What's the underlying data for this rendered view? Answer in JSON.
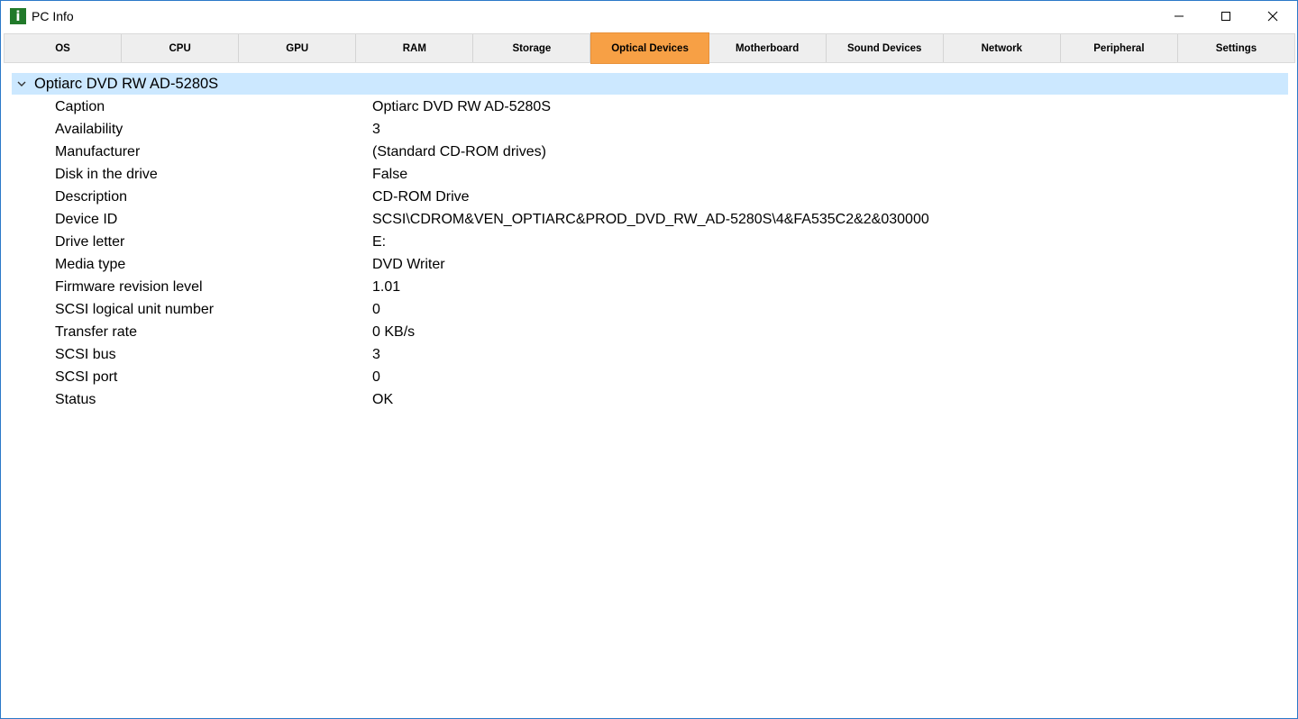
{
  "window": {
    "title": "PC Info",
    "icon_letter": "i",
    "accent": "#217a2a",
    "border_color": "#2b79c8"
  },
  "tabs": [
    {
      "label": "OS",
      "active": false
    },
    {
      "label": "CPU",
      "active": false
    },
    {
      "label": "GPU",
      "active": false
    },
    {
      "label": "RAM",
      "active": false
    },
    {
      "label": "Storage",
      "active": false
    },
    {
      "label": "Optical Devices",
      "active": true
    },
    {
      "label": "Motherboard",
      "active": false
    },
    {
      "label": "Sound Devices",
      "active": false
    },
    {
      "label": "Network",
      "active": false
    },
    {
      "label": "Peripheral",
      "active": false
    },
    {
      "label": "Settings",
      "active": false
    }
  ],
  "active_tab_color": "#f7a045",
  "device": {
    "name": "Optiarc DVD RW AD-5280S",
    "expanded": true,
    "properties": [
      {
        "name": "Caption",
        "value": "Optiarc DVD RW AD-5280S"
      },
      {
        "name": "Availability",
        "value": "3"
      },
      {
        "name": "Manufacturer",
        "value": "(Standard CD-ROM drives)"
      },
      {
        "name": "Disk in the drive",
        "value": "False"
      },
      {
        "name": "Description",
        "value": "CD-ROM Drive"
      },
      {
        "name": "Device ID",
        "value": "SCSI\\CDROM&VEN_OPTIARC&PROD_DVD_RW_AD-5280S\\4&FA535C2&2&030000"
      },
      {
        "name": "Drive letter",
        "value": "E:"
      },
      {
        "name": "Media type",
        "value": "DVD Writer"
      },
      {
        "name": "Firmware revision level",
        "value": "1.01"
      },
      {
        "name": "SCSI logical unit number",
        "value": "0"
      },
      {
        "name": "Transfer rate",
        "value": "0 KB/s"
      },
      {
        "name": "SCSI bus",
        "value": "3"
      },
      {
        "name": "SCSI port",
        "value": "0"
      },
      {
        "name": "Status",
        "value": "OK"
      }
    ]
  },
  "icons": {
    "app": "info-icon",
    "minimize": "minimize-icon",
    "maximize": "maximize-icon",
    "close": "close-icon",
    "expander": "chevron-down-icon"
  }
}
